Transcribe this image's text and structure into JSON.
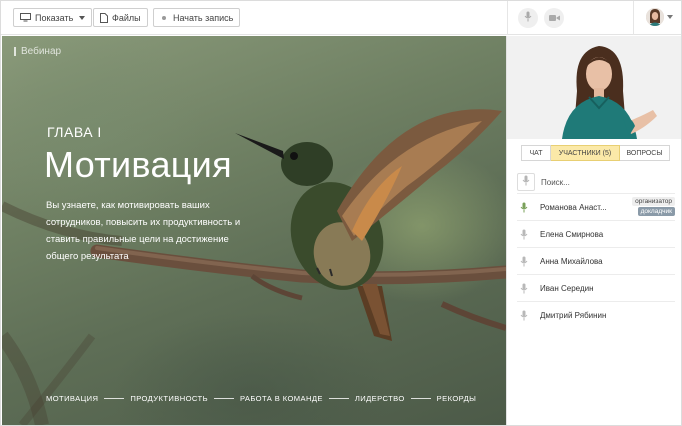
{
  "toolbar": {
    "share_label": "Показать",
    "files_label": "Файлы",
    "record_label": "Начать запись"
  },
  "stage": {
    "webinar_label": "Вебинар",
    "chapter": "ГЛАВА I",
    "headline": "Мотивация",
    "description": "Вы узнаете, как мотивировать ваших сотрудников, повысить их продуктивность и ставить правильные цели на достижение общего результата",
    "nav": [
      "МОТИВАЦИЯ",
      "ПРОДУКТИВНОСТЬ",
      "РАБОТА В КОМАНДЕ",
      "ЛИДЕРСТВО",
      "РЕКОРДЫ"
    ]
  },
  "panel": {
    "tabs": [
      {
        "label": "ЧАТ",
        "active": false
      },
      {
        "label": "УЧАСТНИКИ (5)",
        "active": true
      },
      {
        "label": "ВОПРОСЫ",
        "active": false
      }
    ],
    "search_placeholder": "Поиск...",
    "participants": [
      {
        "name": "Романова Анаст...",
        "mic": "active",
        "badges": [
          "организатор",
          "докладчик"
        ]
      },
      {
        "name": "Елена Смирнова",
        "mic": "muted",
        "badges": []
      },
      {
        "name": "Анна Михайлова",
        "mic": "muted",
        "badges": []
      },
      {
        "name": "Иван Середин",
        "mic": "muted",
        "badges": []
      },
      {
        "name": "Дмитрий Рябинин",
        "mic": "muted",
        "badges": []
      }
    ]
  },
  "colors": {
    "active_tab": "#fbe9a8",
    "active_mic": "#7aa05a",
    "speaker_badge": "#8a9aa8"
  },
  "icons": [
    "monitor-icon",
    "file-icon",
    "record-dot-icon",
    "microphone-icon",
    "camera-icon",
    "user-avatar",
    "chevron-down-icon"
  ]
}
